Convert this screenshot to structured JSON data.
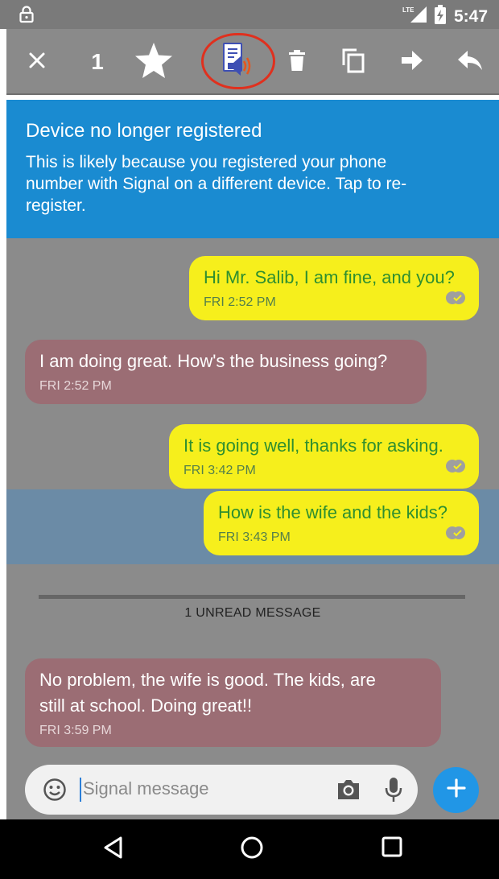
{
  "status_bar": {
    "time": "5:47",
    "network": "LTE",
    "icons": [
      "lock-icon",
      "lte-signal-icon",
      "battery-charging-icon"
    ]
  },
  "toolbar": {
    "selected_count": "1",
    "icons": [
      "close-icon",
      "star-icon",
      "text-to-speech-icon",
      "delete-icon",
      "copy-icon",
      "forward-icon",
      "reply-icon"
    ],
    "highlight_color": "#e0301e"
  },
  "banner": {
    "title": "Device no longer registered",
    "lines": [
      "This is likely because you registered your phone",
      "number with Signal on a different device. Tap to re-",
      "register."
    ],
    "color": "#1a8bd1"
  },
  "messages": [
    {
      "direction": "outgoing",
      "lines": [
        "Hi Mr. Salib, I am fine, and you?"
      ],
      "time": "FRI 2:52 PM",
      "selected": false
    },
    {
      "direction": "incoming",
      "lines": [
        "I am doing great. How's the business going?"
      ],
      "time": "FRI 2:52 PM",
      "selected": false
    },
    {
      "direction": "outgoing",
      "lines": [
        "It is going well, thanks for asking."
      ],
      "time": "FRI 3:42 PM",
      "selected": false
    },
    {
      "direction": "outgoing",
      "lines": [
        "How is the wife and the kids?"
      ],
      "time": "FRI 3:43 PM",
      "selected": true
    },
    {
      "direction": "incoming",
      "lines": [
        "No problem, the wife is good. The kids, are",
        "still at school. Doing great!!"
      ],
      "time": "FRI 3:59 PM",
      "selected": false
    }
  ],
  "unread_divider": "1 UNREAD MESSAGE",
  "composer": {
    "placeholder": "Signal message",
    "icons": [
      "emoji-icon",
      "camera-icon",
      "microphone-icon",
      "plus-icon"
    ]
  },
  "colors": {
    "outgoing_bubble": "#f6ef1c",
    "outgoing_text": "#2f8f2f",
    "incoming_bubble": "#9b6d74",
    "selected_row": "#6b8ba6",
    "send_button": "#2196e6"
  },
  "nav_bar": {
    "icons": [
      "back-icon",
      "home-icon",
      "recents-icon"
    ]
  }
}
